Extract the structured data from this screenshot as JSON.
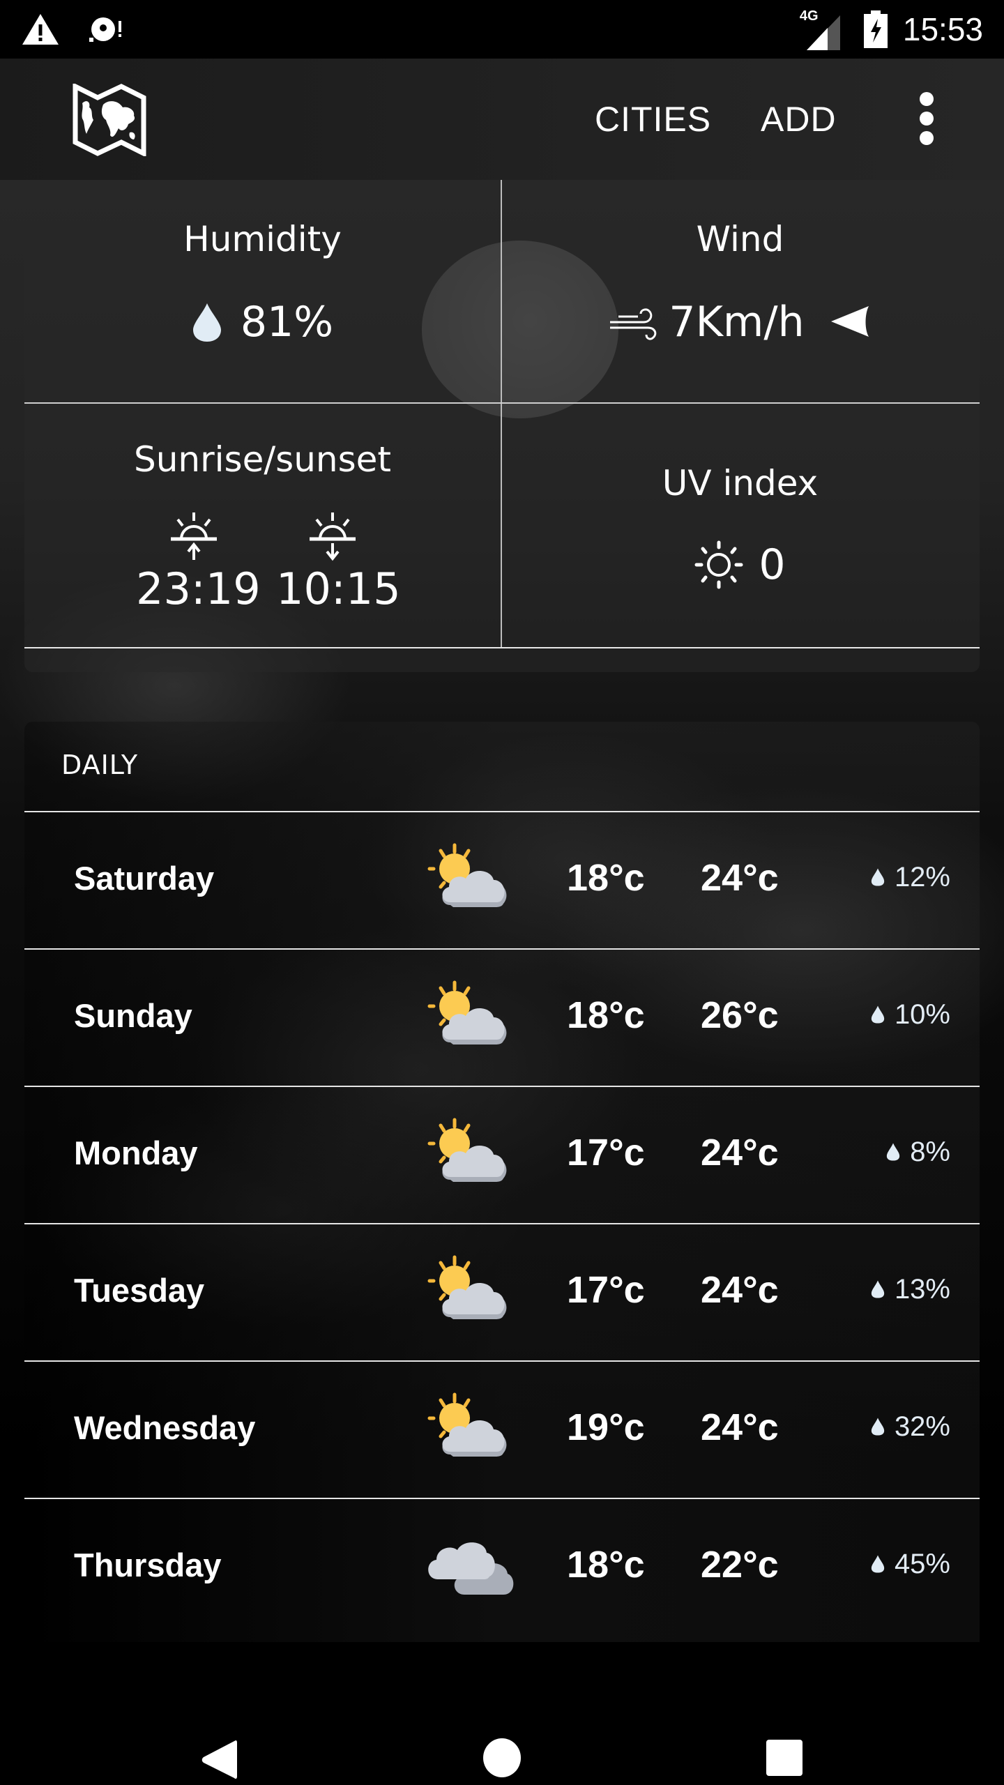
{
  "status_bar": {
    "left_icons": [
      "alert-icon",
      "sync-disc-icon"
    ],
    "network": "4G",
    "time": "15:53"
  },
  "app_bar": {
    "logo": "world-map-icon",
    "actions": [
      {
        "label": "CITIES"
      },
      {
        "label": "ADD"
      }
    ],
    "overflow": "more-vert-icon"
  },
  "details": {
    "humidity": {
      "title": "Humidity",
      "value": "81%"
    },
    "wind": {
      "title": "Wind",
      "value": "7Km/h",
      "direction": "west"
    },
    "sun": {
      "title": "Sunrise/sunset",
      "sunrise": "23:19",
      "sunset": "10:15"
    },
    "uv": {
      "title": "UV index",
      "value": "0"
    }
  },
  "daily": {
    "label": "DAILY",
    "days": [
      {
        "day": "Saturday",
        "icon": "partly-cloudy",
        "low": "18°c",
        "high": "24°c",
        "precip": "12%"
      },
      {
        "day": "Sunday",
        "icon": "partly-cloudy",
        "low": "18°c",
        "high": "26°c",
        "precip": "10%"
      },
      {
        "day": "Monday",
        "icon": "partly-cloudy",
        "low": "17°c",
        "high": "24°c",
        "precip": "8%"
      },
      {
        "day": "Tuesday",
        "icon": "partly-cloudy",
        "low": "17°c",
        "high": "24°c",
        "precip": "13%"
      },
      {
        "day": "Wednesday",
        "icon": "partly-cloudy",
        "low": "19°c",
        "high": "24°c",
        "precip": "32%"
      },
      {
        "day": "Thursday",
        "icon": "cloudy",
        "low": "18°c",
        "high": "22°c",
        "precip": "45%"
      }
    ]
  },
  "nav_bar": {
    "buttons": [
      "back",
      "home",
      "recents"
    ]
  },
  "colors": {
    "sun": "#FCCB52",
    "sun_ray": "#F5B83A",
    "cloud_front": "#CFD3DB",
    "cloud_shadow": "#A9AEB8",
    "drop": "#E1ECF5"
  }
}
